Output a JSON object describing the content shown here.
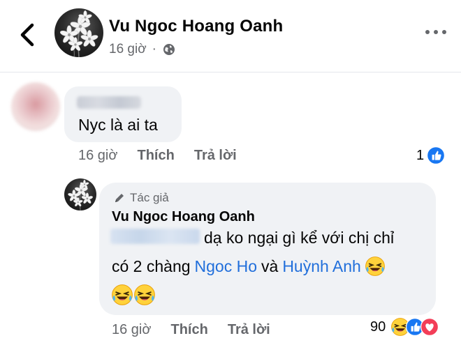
{
  "header": {
    "poster_name": "Vu Ngoc Hoang Oanh",
    "time": "16 giờ",
    "privacy_icon": "globe-icon"
  },
  "comment": {
    "text": "Nyc là ai ta",
    "time": "16 giờ",
    "like_label": "Thích",
    "reply_label": "Trả lời",
    "reaction_count": "1",
    "reaction_icon": "like-reaction-icon"
  },
  "reply": {
    "author_badge": "Tác giả",
    "name": "Vu Ngoc Hoang Oanh",
    "line1": "dạ ko ngại gì kể với chị chỉ",
    "line2_prefix": "có 2 chàng",
    "mention1": "Ngoc Ho",
    "line2_mid": "và",
    "mention2": "Huỳnh Anh",
    "time": "16 giờ",
    "like_label": "Thích",
    "reply_label": "Trả lời",
    "reaction_count": "90",
    "reaction_icons": [
      "laugh-reaction-icon",
      "like-reaction-icon",
      "love-reaction-icon"
    ]
  },
  "colors": {
    "bubble": "#f0f2f5",
    "mention": "#216fdb",
    "meta": "#65676b",
    "like_blue": "#1877f2",
    "love_red": "#f33e58"
  }
}
